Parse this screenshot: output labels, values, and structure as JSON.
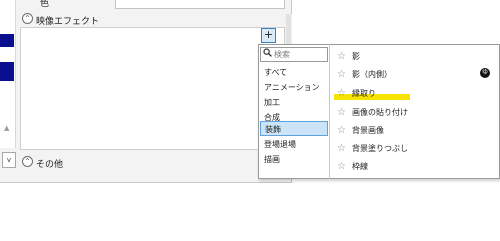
{
  "properties": {
    "color_label": "色",
    "video_effects_label": "映像エフェクト",
    "other_label": "その他",
    "add_button": "+",
    "collapse_glyph": "^",
    "left_dropdown_glyph": "v",
    "left_scroll_glyph": "▲"
  },
  "effect_popup": {
    "search_placeholder": "検索",
    "search_icon": "magnifier-icon",
    "categories": [
      {
        "label": "すべて"
      },
      {
        "label": "アニメーション"
      },
      {
        "label": "加工"
      },
      {
        "label": "合成"
      },
      {
        "label": "装飾",
        "selected": true
      },
      {
        "label": "登場退場"
      },
      {
        "label": "描画"
      }
    ],
    "effects": [
      {
        "label": "影"
      },
      {
        "label": "影（内側）",
        "badge": "ゆ"
      },
      {
        "label": "縁取り",
        "highlighted": true
      },
      {
        "label": "画像の貼り付け"
      },
      {
        "label": "背景画像"
      },
      {
        "label": "背景塗りつぶし"
      },
      {
        "label": "枠線"
      }
    ],
    "star_glyph": "☆",
    "highlight_color": "#f7e300",
    "selected_color": "#cce4f7"
  },
  "colors": {
    "navy_swatch": "#0a0f8f",
    "panel_bg": "#f3f3f3",
    "accent_border": "#3c7fc1"
  }
}
